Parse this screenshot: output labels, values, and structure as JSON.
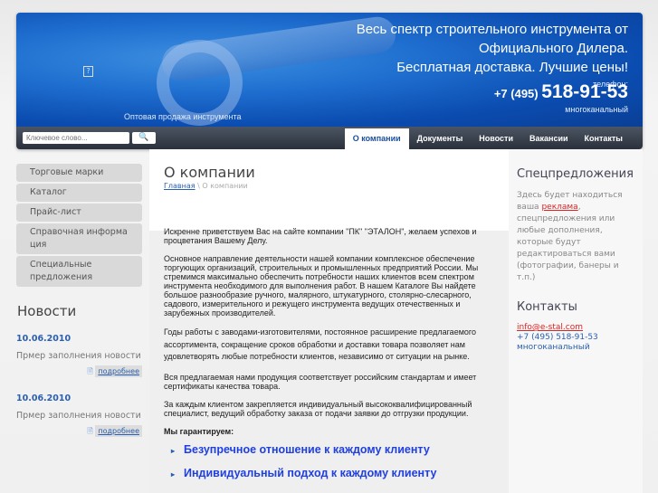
{
  "header": {
    "slogan": [
      "Весь спектр строительного инструмента от",
      "Официального Дилера.",
      "Бесплатная доставка. Лучшие цены!"
    ],
    "phone_label": "телефон:",
    "phone_prefix": "+7 (495)",
    "phone_number": "518-91-53",
    "phone_note": "многоканальный",
    "tagline": "Оптовая продажа инструмента",
    "logo_placeholder": "?"
  },
  "search": {
    "placeholder": "Ключевое слово...",
    "button_icon": "search-icon"
  },
  "nav": {
    "tabs": [
      "О компании",
      "Документы",
      "Новости",
      "Вакансии",
      "Контакты"
    ],
    "active": "О компании"
  },
  "sidebar": {
    "menu": [
      "Торговые марки",
      "Каталог",
      "Прайс-лист",
      "Справочная информация",
      "Специальные предложения"
    ],
    "news_title": "Новости",
    "news": [
      {
        "date": "10.06.2010",
        "text": "Прмер заполнения новости",
        "more": "подробнее"
      },
      {
        "date": "10.06.2010",
        "text": "Прмер заполнения новости",
        "more": "подробнее"
      }
    ]
  },
  "main": {
    "title": "О компании",
    "breadcrumb": {
      "home": "Главная",
      "sep": "\\",
      "current": "О компании"
    },
    "paragraphs": [
      "Искренне приветствуем Вас на сайте компании \"ПК\" \"ЭТАЛОН\", желаем успехов и процветания Вашему Делу.",
      "Основное направление деятельности нашей компании   комплексное обеспечение торгующих организаций, строительных и промышленных предприятий России. Мы стремимся максимально обеспечить потребности наших клиентов всем спектром инструмента необходимого для выполнения работ. В нашем Каталоге Вы найдете большое разнообразие ручного, малярного, штукатурного, столярно-слесарного, садового, измерительного и режущего инструмента ведущих отечественных и зарубежных производителей.",
      "Годы работы с заводами-изготовителями, постоянное расширение предлагаемого  ассортимента, сокращение сроков обработки и доставки товара позволяет нам удовлетворять любые потребности клиентов, независимо от ситуации на рынке.",
      "Вся предлагаемая нами продукция соответствует российским стандартам и имеет сертификаты качества товара.",
      "За каждым клиентом закрепляется индивидуальный высококвалифицированный специалист, ведущий обработку заказа от подачи заявки до отгрузки продукции."
    ],
    "guarantee_title": "Мы гарантируем:",
    "guarantees": [
      "Безупречное отношение к каждому клиенту",
      "Индивидуальный подход к каждому клиенту"
    ]
  },
  "right": {
    "special_title": "Спецпредложения",
    "special_before": "Здесь будет находиться ваша ",
    "special_link": "реклама",
    "special_after": ", спецпредложения или любые дополнения, которые будут редактироваться вами (фотографии, банеры и т.п.)",
    "contacts_title": "Контакты",
    "email": "info@e-stal.com",
    "phone": "+7 (495) 518-91-53",
    "phone_note": "многоканальный"
  }
}
